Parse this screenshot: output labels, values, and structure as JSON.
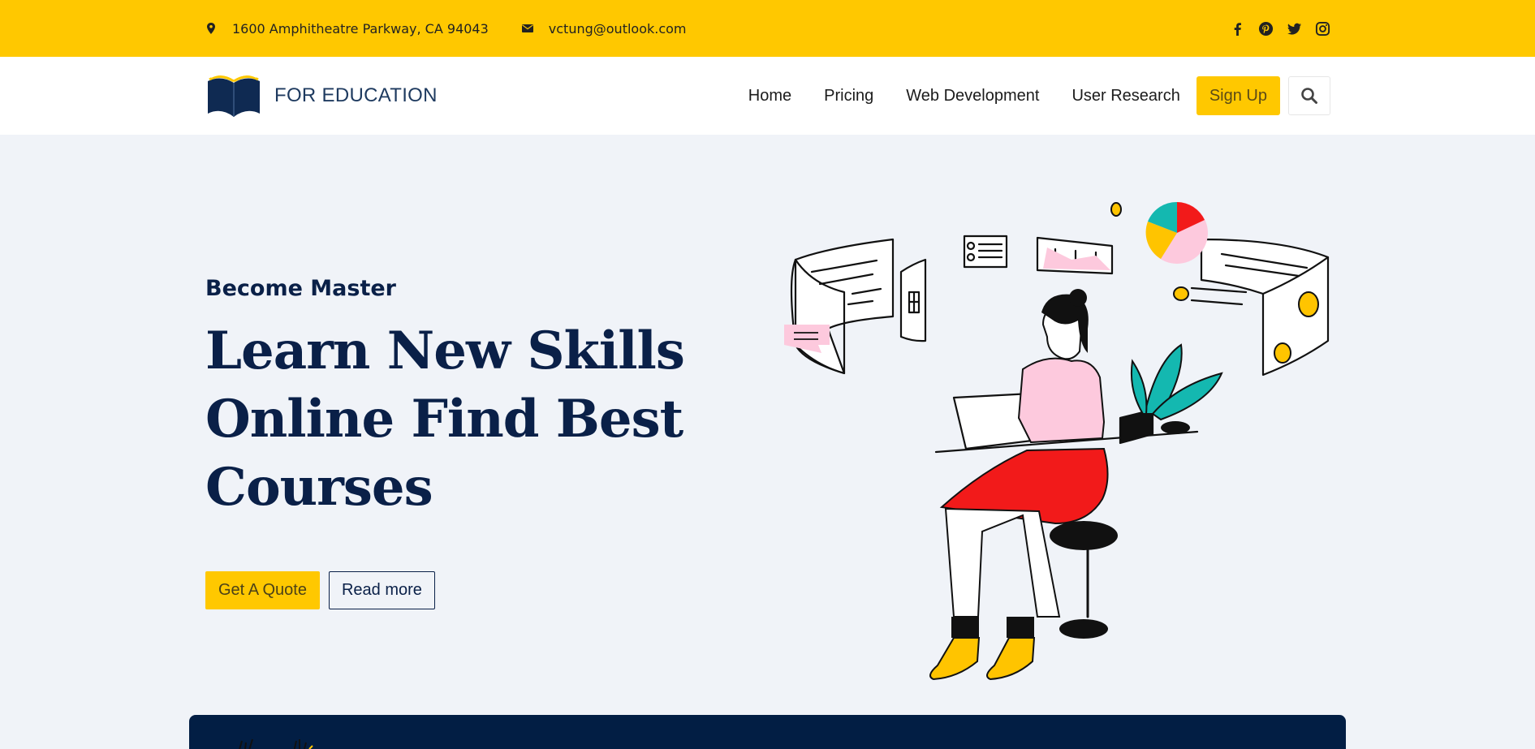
{
  "topbar": {
    "address": "1600 Amphitheatre Parkway, CA 94043",
    "email": "vctung@outlook.com",
    "icons": [
      "map-marker-icon",
      "envelope-icon",
      "facebook-icon",
      "pinterest-icon",
      "twitter-icon",
      "instagram-icon"
    ]
  },
  "header": {
    "logo_text": "FOR EDUCATION",
    "nav": [
      "Home",
      "Pricing",
      "Web Development",
      "User Research"
    ],
    "signup_label": "Sign Up",
    "search_icon": "search-icon"
  },
  "hero": {
    "eyebrow": "Become Master",
    "headline_line1": "Learn New Skills",
    "headline_line2": "Online Find Best",
    "headline_line3": "Courses",
    "quote_label": "Get A Quote",
    "read_label": "Read more"
  },
  "colors": {
    "accent": "#ffc800",
    "navy": "#0a2048",
    "band": "#021e44",
    "background": "#f0f3f8"
  }
}
